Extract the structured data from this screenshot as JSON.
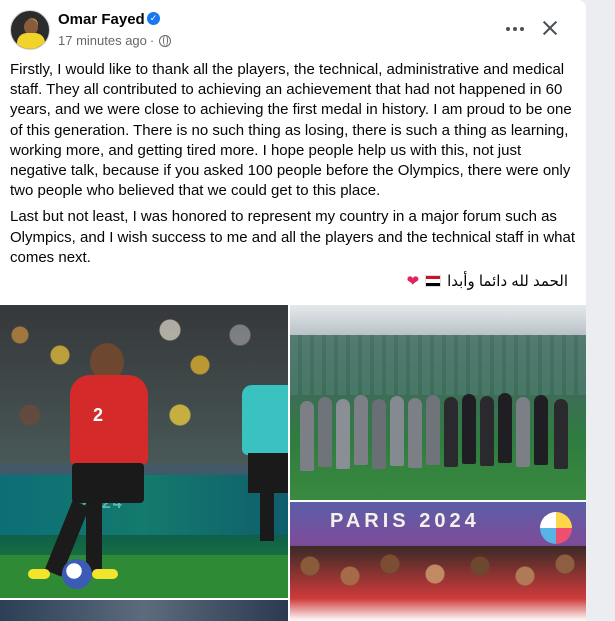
{
  "post": {
    "author": "Omar Fayed",
    "time": "17 minutes ago",
    "separator": "·",
    "paragraphs": [
      "Firstly, I would like to thank all the players, the technical, administrative and medical staff. They all contributed to achieving an achievement that had not happened in 60 years, and we were close to achieving the first medal in history. I am proud to be one of this generation. There is no such thing as losing, there is such a thing as learning, working more, and getting tired more. I hope people help us with this, not just negative talk, because if you asked 100 people before the Olympics, there were only two people who believed that we could get to this place.",
      "Last but not least, I was honored to represent my country in a major forum such as Olympics, and I wish success to me and all the players and the technical staff in what comes next."
    ],
    "arabic_line": "الحمد لله دائما وأبدا"
  },
  "icons": {
    "verified": "verified-badge-icon",
    "globe": "globe-icon",
    "more": "more-options-icon",
    "close": "close-icon",
    "flag": "egypt-flag-icon",
    "heart": "red-heart-icon"
  },
  "photos": {
    "paris_banner": "PARIS 2024",
    "adboard": "2024"
  },
  "colors": {
    "link": "#1877f2",
    "meta": "#65676b",
    "text": "#050505",
    "background": "#ebedf0",
    "heart": "#e0245e"
  }
}
